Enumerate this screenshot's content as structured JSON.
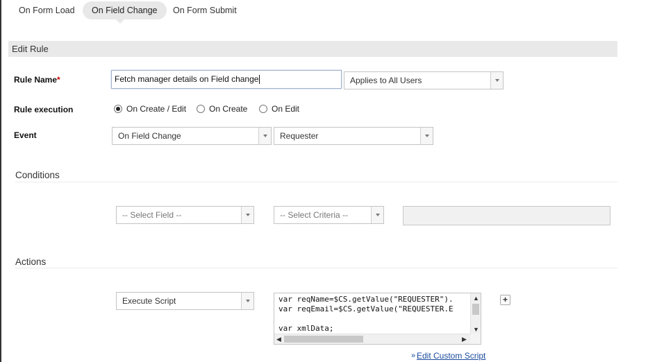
{
  "tabs": [
    {
      "label": "On Form Load",
      "active": false
    },
    {
      "label": "On Field Change",
      "active": true
    },
    {
      "label": "On Form Submit",
      "active": false
    }
  ],
  "section_title": "Edit Rule",
  "rule_name": {
    "label": "Rule Name",
    "required_marker": "*",
    "value": "Fetch manager details on Field change",
    "applies_to": "Applies to All Users"
  },
  "rule_execution": {
    "label": "Rule execution",
    "options": [
      {
        "label": "On Create / Edit",
        "selected": true
      },
      {
        "label": "On Create",
        "selected": false
      },
      {
        "label": "On Edit",
        "selected": false
      }
    ]
  },
  "event": {
    "label": "Event",
    "trigger": "On Field Change",
    "field": "Requester"
  },
  "conditions": {
    "title": "Conditions",
    "field_placeholder": "-- Select Field --",
    "criteria_placeholder": "-- Select Criteria --",
    "value": ""
  },
  "actions": {
    "title": "Actions",
    "action_type": "Execute Script",
    "script_lines": [
      "var reqName=$CS.getValue(\"REQUESTER\").",
      "var reqEmail=$CS.getValue(\"REQUESTER.E",
      "",
      "var xmlData;"
    ],
    "add_label": "+",
    "edit_link_prefix": "»",
    "edit_link": "Edit Custom Script"
  },
  "colors": {
    "accent_link": "#1a4a9c",
    "required": "#cc0000",
    "section_header_bg": "#e9e9e9"
  }
}
